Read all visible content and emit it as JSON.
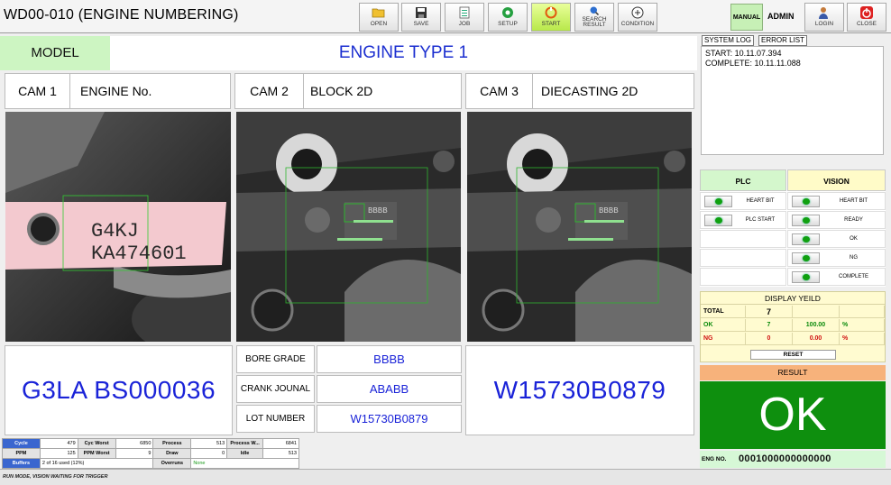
{
  "app": {
    "title": "WD00-010 (ENGINE NUMBERING)"
  },
  "toolbar": {
    "open": "OPEN",
    "save": "SAVE",
    "job": "JOB",
    "setup": "SETUP",
    "start": "START",
    "search_result": "SEARCH\nRESULT",
    "condition": "CONDITION",
    "mode": "MANUAL",
    "user": "ADMIN",
    "login": "LOGIN",
    "close": "CLOSE"
  },
  "model": {
    "label": "MODEL",
    "value": "ENGINE TYPE 1"
  },
  "cams": [
    {
      "no": "CAM 1",
      "name": "ENGINE No.",
      "ocr_line1": "G4KJ",
      "ocr_line2": "KA474601"
    },
    {
      "no": "CAM 2",
      "name": "BLOCK 2D",
      "code_text": "BBBB"
    },
    {
      "no": "CAM 3",
      "name": "DIECASTING 2D",
      "code_text": "BBBB"
    }
  ],
  "results": {
    "cam1": "G3LA BS000036",
    "cam3": "W15730B0879",
    "grades": [
      {
        "label": "BORE GRADE",
        "value": "BBBB"
      },
      {
        "label": "CRANK JOUNAL",
        "value": "ABABB"
      },
      {
        "label": "LOT NUMBER",
        "value": "W15730B0879"
      }
    ]
  },
  "stats": {
    "cycle_label": "Cycle",
    "cycle": "479",
    "cyc_worst_label": "Cyc Worst",
    "cyc_worst": "6850",
    "process_label": "Process",
    "process": "513",
    "process_w_label": "Process W...",
    "process_w": "6841",
    "ppm_label": "PPM",
    "ppm": "125",
    "ppm_worst_label": "PPM Worst",
    "ppm_worst": "9",
    "draw_label": "Draw",
    "draw": "0",
    "idle_label": "Idle",
    "idle": "513",
    "buffers_label": "Buffers",
    "buffers": "2 of 16 used (12%)",
    "overruns_label": "Overruns",
    "overruns": "None"
  },
  "status_text": "RUN MODE, VISION WAITING FOR TRIGGER",
  "log": {
    "tab_system": "SYSTEM LOG",
    "tab_error": "ERROR LIST",
    "lines": [
      "START: 10.11.07.394",
      "COMPLETE: 10.11.11.088"
    ]
  },
  "io": {
    "plc_header": "PLC",
    "vision_header": "VISION",
    "plc": [
      "HEART BIT",
      "PLC START"
    ],
    "vision": [
      "HEART BIT",
      "READY",
      "OK",
      "NG",
      "COMPLETE"
    ],
    "led_color": "#10a010"
  },
  "yield": {
    "title": "DISPLAY YEILD",
    "total_label": "TOTAL",
    "total": "7",
    "ok_label": "OK",
    "ok": "7",
    "ok_pct": "100.00",
    "pct_sign": "%",
    "ng_label": "NG",
    "ng": "0",
    "ng_pct": "0.00",
    "reset": "RESET"
  },
  "result": {
    "title": "RESULT",
    "value": "OK",
    "eng_label": "ENG NO.",
    "eng_no": "0001000000000000"
  },
  "colors": {
    "accent_blue": "#1a23d8",
    "ok_green": "#0e8f0e",
    "model_green": "#cdf5c2",
    "result_orange": "#f7b27b"
  }
}
